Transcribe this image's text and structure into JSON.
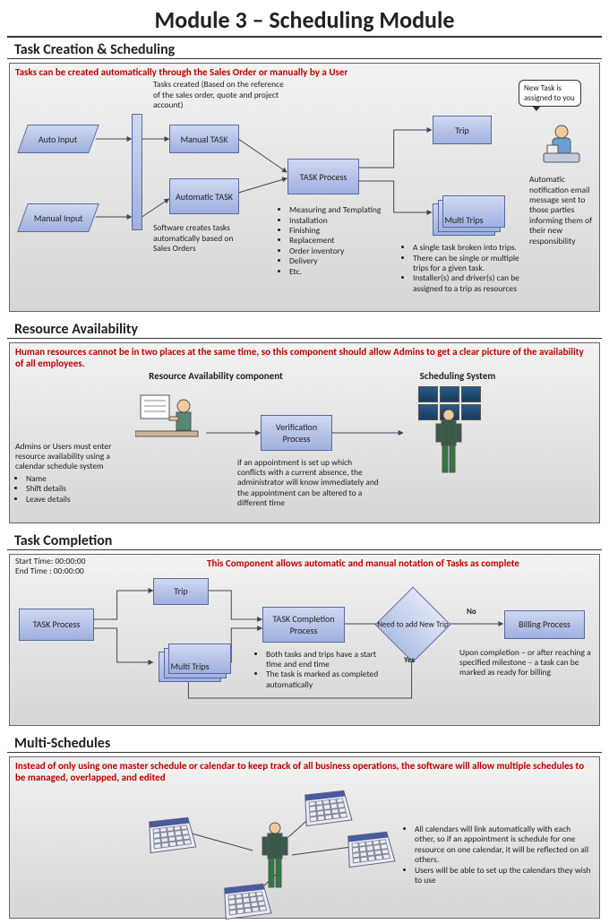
{
  "pageTitle": "Module 3 – Scheduling Module",
  "s1": {
    "title": "Task Creation & Scheduling",
    "intro": "Tasks can be created automatically through the Sales Order or manually by a User",
    "tasksCreatedNote": "Tasks created (Based on the reference of the sales order, quote and project account)",
    "autoInput": "Auto Input",
    "manualInput": "Manual Input",
    "manualTask": "Manual TASK",
    "automaticTask": "Automatic TASK",
    "softwareNote": "Software creates tasks automatically based on Sales Orders",
    "taskProcess": "TASK Process",
    "processBullets": [
      "Measuring and Templating",
      "Installation",
      "Finishing",
      "Replacement",
      "Order inventory",
      "Delivery",
      "Etc."
    ],
    "trip": "Trip",
    "multiTrips": "Multi Trips",
    "tripBullets": [
      "A single task broken into trips.",
      "There can be single or multiple trips for a given task.",
      "Installer(s) and driver(s) can be assigned to a trip as resources"
    ],
    "speech": "New Task is assigned to you",
    "notifyNote": "Automatic notification email message sent to those parties informing them of their new responsibility"
  },
  "s2": {
    "title": "Resource Availability",
    "intro": "Human resources cannot be in two places at the same time, so this component should allow Admins to get a clear picture of the availability of all employees.",
    "leftHeading": "Resource Availability component",
    "rightHeading": "Scheduling System",
    "leftNoteIntro": "Admins or Users must enter resource availability using a calendar schedule system",
    "leftBullets": [
      "Name",
      "Shift details",
      "Leave details"
    ],
    "verify": "Verification Process",
    "verifyNote": "if an appointment is set up which conflicts with a current absence, the administrator will know immediately and the appointment can be altered to a different time"
  },
  "s3": {
    "title": "Task Completion",
    "times": "Start Time: 00:00:00\nEnd Time : 00:00:00",
    "intro": "This Component allows automatic and manual notation of Tasks as complete",
    "taskProcess": "TASK Process",
    "trip": "Trip",
    "multiTrips": "Multi Trips",
    "completion": "TASK Completion Process",
    "completionBullets": [
      "Both tasks and trips have a start time and end time",
      "The task is marked as completed automatically"
    ],
    "decision": "Need to add New Trip",
    "no": "No",
    "yes": "Yes",
    "billing": "Billing Process",
    "billingNote": "Upon completion – or after reaching a specified milestone – a task can be marked as ready for billing"
  },
  "s4": {
    "title": "Multi-Schedules",
    "intro": "Instead of only using one master schedule or calendar to keep track of all business operations, the software will allow multiple schedules to be managed, overlapped, and edited",
    "bullets": [
      "All calendars will link automatically with each other, so if an appointment is schedule for one resource on one calendar, it will be reflected on all others.",
      "Users will be able to set up the calendars they wish to use"
    ]
  }
}
